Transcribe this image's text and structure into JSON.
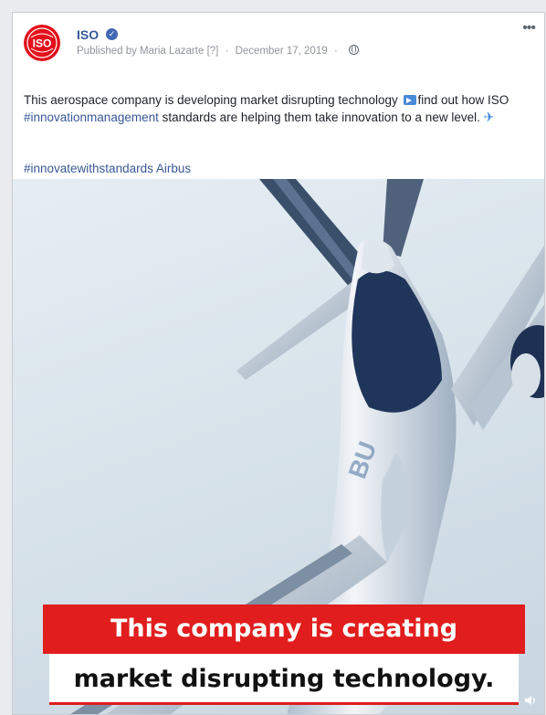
{
  "post": {
    "page_name": "ISO",
    "avatar_text": "ISO",
    "meta": {
      "published_by": "Published by Maria Lazarte",
      "help_marker": "[?]",
      "separator": "·",
      "date": "December 17, 2019",
      "privacy_icon": "globe-icon"
    },
    "more_label": "•••",
    "text": {
      "part1": "This aerospace company is developing market disrupting technology",
      "part2": "find out how ISO",
      "hashtag1": "#innovationmanagement",
      "part3": "standards are helping them take innovation to a new level.",
      "emoji1": "play-button-emoji",
      "emoji2": "airplane-emoji"
    },
    "tags": {
      "hashtag": "#innovatewithstandards",
      "mention": "Airbus"
    },
    "video": {
      "caption_line1": "This company is creating",
      "caption_line2": "market disrupting technology.",
      "volume_icon": "volume-icon"
    }
  },
  "colors": {
    "brand_red": "#e3101b",
    "caption_red": "#e11d1d",
    "link_blue": "#385898",
    "verified_blue": "#4267b2"
  }
}
